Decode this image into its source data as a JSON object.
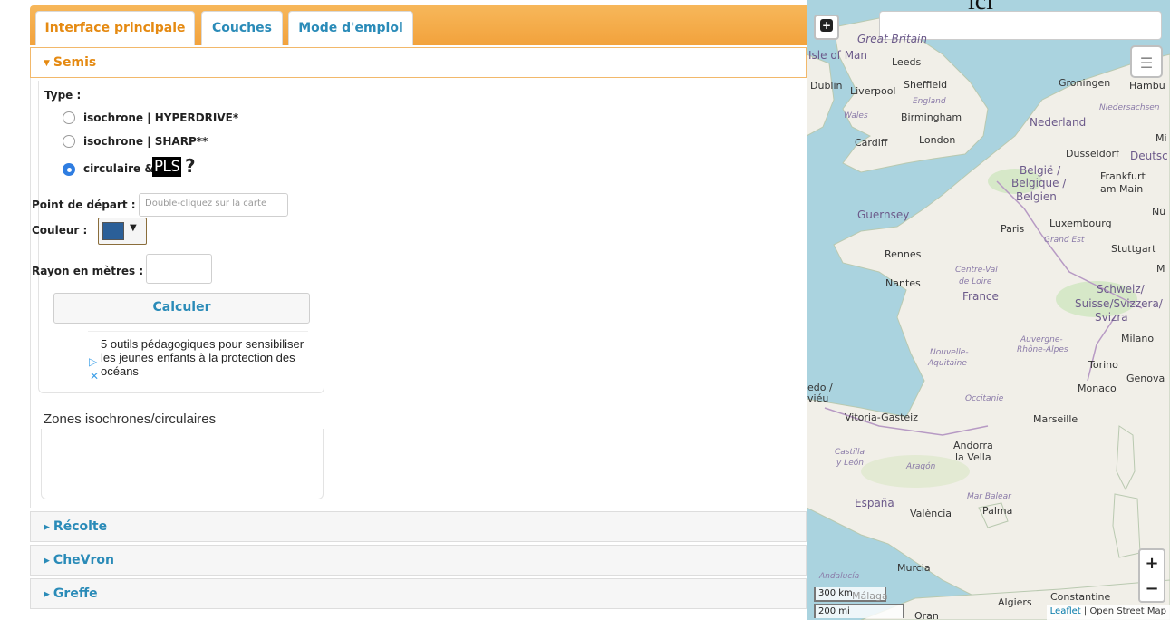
{
  "tabs": [
    {
      "label": "Interface principale",
      "active": true
    },
    {
      "label": "Couches",
      "active": false
    },
    {
      "label": "Mode d'emploi",
      "active": false
    }
  ],
  "semis": {
    "title": "Semis",
    "type_label": "Type :",
    "options": [
      {
        "label": "isochrone | HYPERDRIVE*",
        "selected": false
      },
      {
        "label": "isochrone | SHARP**",
        "selected": false
      },
      {
        "label": "circulaire &",
        "selected": true
      }
    ],
    "pls_badge": "PLS",
    "help_mark": "?",
    "start_label": "Point de départ :",
    "start_placeholder": "Double-cliquez sur la carte",
    "color_label": "Couleur :",
    "color_value": "#2b5f98",
    "caret": "▼",
    "radius_label": "Rayon en mètres :",
    "radius_value": "",
    "calc_button": "Calculer"
  },
  "ad": {
    "text": "5 outils pédagogiques pour sensibiliser les jeunes enfants à la protection des océans",
    "play_icon": "▷",
    "close_icon": "✕"
  },
  "zones_title": "Zones isochrones/circulaires",
  "sections": [
    {
      "label": "Récolte"
    },
    {
      "label": "CheVron"
    },
    {
      "label": "Greffe"
    }
  ],
  "map": {
    "overlay_text": "ici",
    "search_value": "",
    "zoom_in": "+",
    "zoom_out": "−",
    "scale_km": "300 km",
    "scale_mi": "200 mi",
    "attribution_leaflet": "Leaflet",
    "attribution_rest": "| Open Street Map",
    "places": [
      {
        "name": "Great Britain",
        "kind": "country"
      },
      {
        "name": "Isle of Man",
        "kind": "country"
      },
      {
        "name": "Leeds",
        "kind": "city"
      },
      {
        "name": "Dublin",
        "kind": "city"
      },
      {
        "name": "Liverpool",
        "kind": "city"
      },
      {
        "name": "Sheffield",
        "kind": "city"
      },
      {
        "name": "England",
        "kind": "region"
      },
      {
        "name": "Wales",
        "kind": "region"
      },
      {
        "name": "Birmingham",
        "kind": "city"
      },
      {
        "name": "Cardiff",
        "kind": "city"
      },
      {
        "name": "London",
        "kind": "city"
      },
      {
        "name": "Groningen",
        "kind": "city"
      },
      {
        "name": "Hambu",
        "kind": "city"
      },
      {
        "name": "Niedersachsen",
        "kind": "region"
      },
      {
        "name": "Nederland",
        "kind": "country"
      },
      {
        "name": "Dusseldorf",
        "kind": "city"
      },
      {
        "name": "Deutsc",
        "kind": "country"
      },
      {
        "name": "België /",
        "kind": "country"
      },
      {
        "name": "Belgique /",
        "kind": "country"
      },
      {
        "name": "Belgien",
        "kind": "country"
      },
      {
        "name": "Frankfurt",
        "kind": "city"
      },
      {
        "name": "am Main",
        "kind": "city"
      },
      {
        "name": "Guernsey",
        "kind": "country"
      },
      {
        "name": "Paris",
        "kind": "city"
      },
      {
        "name": "Luxembourg",
        "kind": "city"
      },
      {
        "name": "Grand Est",
        "kind": "region"
      },
      {
        "name": "Stuttgart",
        "kind": "city"
      },
      {
        "name": "Rennes",
        "kind": "city"
      },
      {
        "name": "Centre-Val",
        "kind": "region"
      },
      {
        "name": "de Loire",
        "kind": "region"
      },
      {
        "name": "Nantes",
        "kind": "city"
      },
      {
        "name": "France",
        "kind": "country"
      },
      {
        "name": "Schweiz/",
        "kind": "country"
      },
      {
        "name": "Suisse/Svizzera/",
        "kind": "country"
      },
      {
        "name": "Svizra",
        "kind": "country"
      },
      {
        "name": "Auvergne-",
        "kind": "region"
      },
      {
        "name": "Rhône-Alpes",
        "kind": "region"
      },
      {
        "name": "Milano",
        "kind": "city"
      },
      {
        "name": "Nouvelle-",
        "kind": "region"
      },
      {
        "name": "Aquitaine",
        "kind": "region"
      },
      {
        "name": "Torino",
        "kind": "city"
      },
      {
        "name": "Genova",
        "kind": "city"
      },
      {
        "name": "Monaco",
        "kind": "city"
      },
      {
        "name": "Occitanie",
        "kind": "region"
      },
      {
        "name": "Vitoria-Gasteiz",
        "kind": "city"
      },
      {
        "name": "Marseille",
        "kind": "city"
      },
      {
        "name": "Andorra",
        "kind": "city"
      },
      {
        "name": "la Vella",
        "kind": "city"
      },
      {
        "name": "Castilla",
        "kind": "region"
      },
      {
        "name": "y León",
        "kind": "region"
      },
      {
        "name": "Aragón",
        "kind": "region"
      },
      {
        "name": "España",
        "kind": "country"
      },
      {
        "name": "València",
        "kind": "city"
      },
      {
        "name": "Palma",
        "kind": "city"
      },
      {
        "name": "Mar Balear",
        "kind": "region"
      },
      {
        "name": "Murcia",
        "kind": "city"
      },
      {
        "name": "Andalucía",
        "kind": "region"
      },
      {
        "name": "Málaga",
        "kind": "city"
      },
      {
        "name": "Algiers",
        "kind": "city"
      },
      {
        "name": "Constantine",
        "kind": "city"
      },
      {
        "name": "Oran",
        "kind": "city"
      },
      {
        "name": "edo /",
        "kind": "city"
      },
      {
        "name": "viéu",
        "kind": "city"
      },
      {
        "name": "Nü",
        "kind": "city"
      },
      {
        "name": "Mi",
        "kind": "city"
      },
      {
        "name": "M",
        "kind": "city"
      }
    ]
  },
  "colors": {
    "accent_orange": "#f2a23c",
    "link_blue": "#2a8bb8",
    "active_orange": "#e58a12",
    "radio_blue": "#2f7de1",
    "sea": "#aad3df",
    "land": "#f1efe8"
  }
}
